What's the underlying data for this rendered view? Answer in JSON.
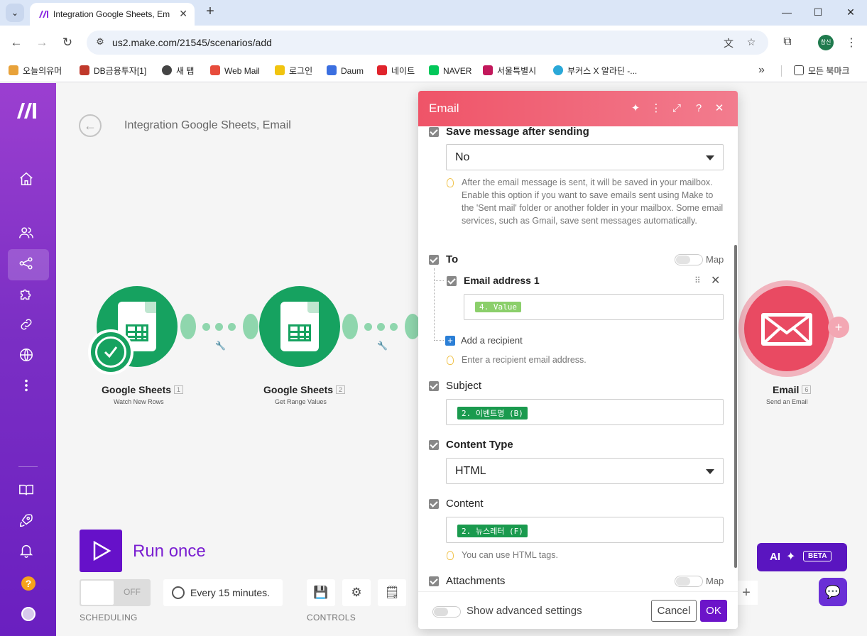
{
  "browser": {
    "tab_title": "Integration Google Sheets, Em",
    "url": "us2.make.com/21545/scenarios/add",
    "profile_initials": "창신",
    "bookmarks": [
      "오늘의유머",
      "DB금융투자[1]",
      "새 탭",
      "Web Mail",
      "로그인",
      "Daum",
      "네이트",
      "NAVER",
      "서울특별시",
      "부커스 X 알라딘 -..."
    ],
    "bookmarks_folder": "모든 북마크"
  },
  "scenario": {
    "title": "Integration Google Sheets, Email",
    "modules": [
      {
        "name": "Google Sheets",
        "number": "1",
        "action": "Watch New Rows"
      },
      {
        "name": "Google Sheets",
        "number": "2",
        "action": "Get Range Values"
      },
      {
        "name": "Email",
        "number": "6",
        "action": "Send an Email"
      }
    ]
  },
  "controls": {
    "run_once": "Run once",
    "scheduling_state": "OFF",
    "schedule": "Every 15 minutes.",
    "scheduling_label": "SCHEDULING",
    "controls_label": "CONTROLS"
  },
  "ai": {
    "label": "AI",
    "badge": "BETA"
  },
  "panel": {
    "title": "Email",
    "save_message_label": "Save message after sending",
    "save_message_value": "No",
    "save_message_hint": "After the email message is sent, it will be saved in your mailbox. Enable this option if you want to save emails sent using Make to the 'Sent mail' folder or another folder in your mailbox. Some email services, such as Gmail, save sent messages automatically.",
    "to_label": "To",
    "map_label": "Map",
    "email_address_label": "Email address 1",
    "email_address_value": "4. Value",
    "add_recipient": "Add a recipient",
    "to_hint": "Enter a recipient email address.",
    "subject_label": "Subject",
    "subject_value": "2. 이벤트명 (B)",
    "content_type_label": "Content Type",
    "content_type_value": "HTML",
    "content_label": "Content",
    "content_value": "2. 뉴스레터 (F)",
    "content_hint": "You can use HTML tags.",
    "attachments_label": "Attachments",
    "advanced_label": "Show advanced settings",
    "cancel": "Cancel",
    "ok": "OK"
  },
  "colors": {
    "sidebar": "#7b2fc4",
    "google_sheets": "#16a260",
    "email_module": "#e94a62",
    "primary_button": "#6c14c9",
    "panel_header": "#ef5468"
  }
}
